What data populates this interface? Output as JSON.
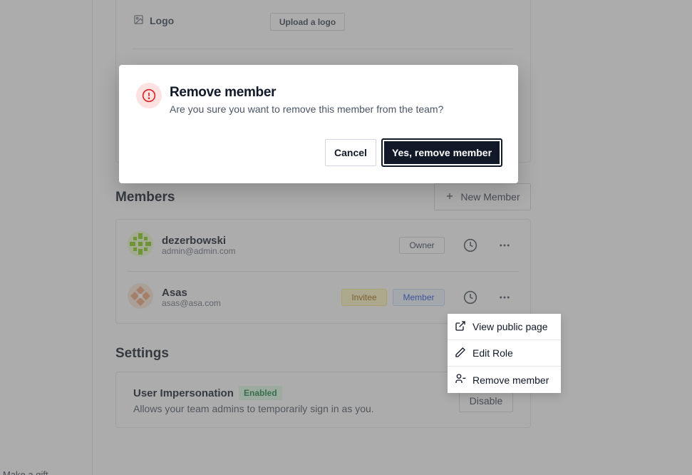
{
  "sidebar": {
    "bottom_text": "Make a gift"
  },
  "profile": {
    "logo_label": "Logo",
    "upload_button": "Upload a logo"
  },
  "members": {
    "title": "Members",
    "new_member_button": "New Member",
    "rows": [
      {
        "name": "dezerbowski",
        "email": "admin@admin.com",
        "badges": [
          "Owner"
        ]
      },
      {
        "name": "Asas",
        "email": "asas@asa.com",
        "badges": [
          "Invitee",
          "Member"
        ]
      }
    ]
  },
  "settings": {
    "title": "Settings",
    "impersonation_title": "User Impersonation",
    "impersonation_badge": "Enabled",
    "impersonation_desc": "Allows your team admins to temporarily sign in as you.",
    "disable_button": "Disable"
  },
  "dropdown": {
    "items": [
      {
        "label": "View public page",
        "icon": "external-link-icon"
      },
      {
        "label": "Edit Role",
        "icon": "pencil-icon"
      },
      {
        "label": "Remove member",
        "icon": "user-minus-icon"
      }
    ]
  },
  "modal": {
    "title": "Remove member",
    "message": "Are you sure you want to remove this member from the team?",
    "cancel": "Cancel",
    "confirm": "Yes, remove member",
    "icon": "alert-circle-icon"
  },
  "colors": {
    "danger": "#dc2626",
    "primary": "#111827",
    "overlay": "rgba(90,90,90,0.5)"
  }
}
